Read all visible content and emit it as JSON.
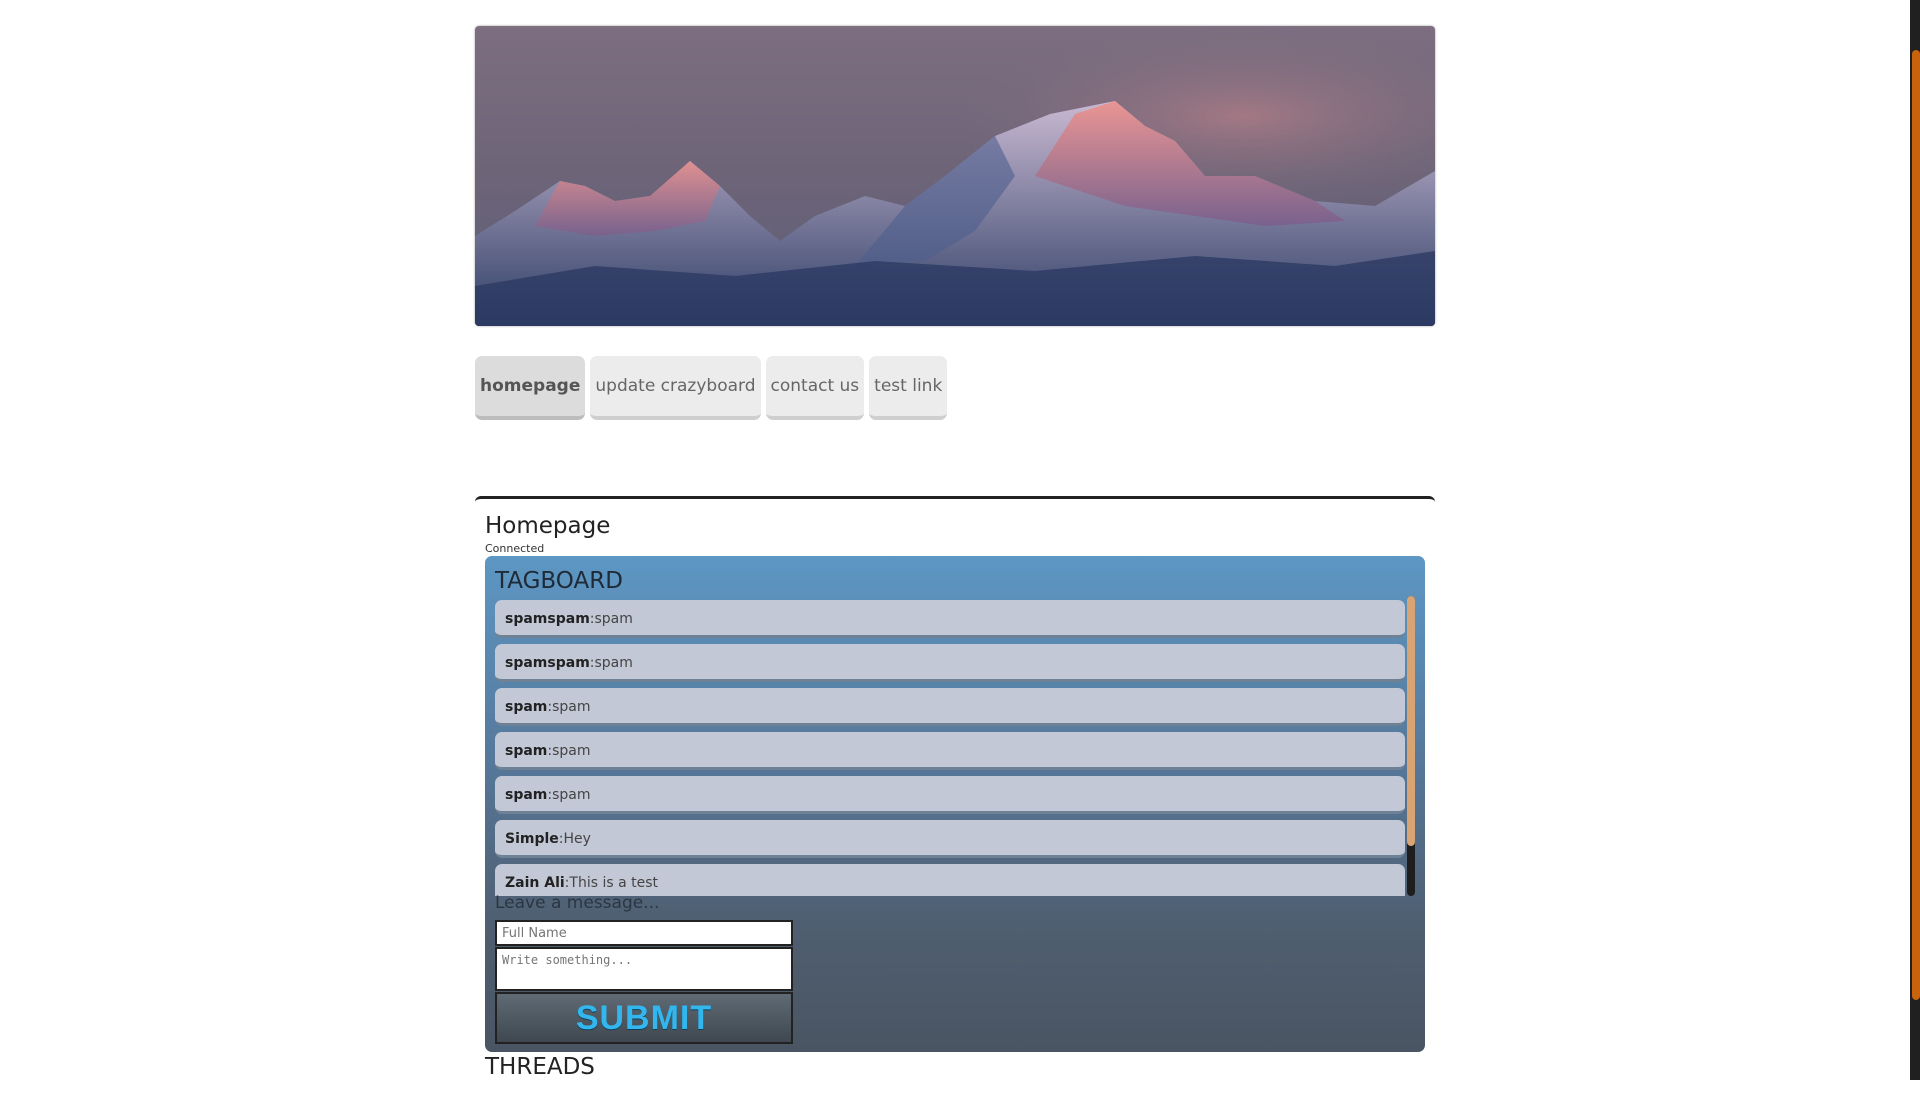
{
  "nav": {
    "tabs": [
      {
        "label": "homepage",
        "active": true
      },
      {
        "label": "update crazyboard",
        "active": false
      },
      {
        "label": "contact us",
        "active": false
      },
      {
        "label": "test link",
        "active": false
      }
    ]
  },
  "content": {
    "title": "Homepage",
    "status": "Connected"
  },
  "tagboard": {
    "title": "TAGBOARD",
    "messages": [
      {
        "author": "spamspam",
        "text": "spam"
      },
      {
        "author": "spamspam",
        "text": "spam"
      },
      {
        "author": "spam",
        "text": "spam"
      },
      {
        "author": "spam",
        "text": "spam"
      },
      {
        "author": "spam",
        "text": "spam"
      },
      {
        "author": "Simple",
        "text": "Hey"
      },
      {
        "author": "Zain Ali",
        "text": "This is a test"
      }
    ],
    "form": {
      "label": "Leave a message...",
      "name_placeholder": "Full Name",
      "message_placeholder": "Write something...",
      "submit_label": "SUBMIT"
    }
  },
  "threads": {
    "title": "THREADS"
  },
  "colors": {
    "accent_scrollbar": "#c7620d",
    "submit_text": "#33b6ee",
    "tagboard_top": "#5d97c4",
    "tagboard_bottom": "#4a5563"
  },
  "icons": {
    "banner": "mountain-banner-image"
  }
}
